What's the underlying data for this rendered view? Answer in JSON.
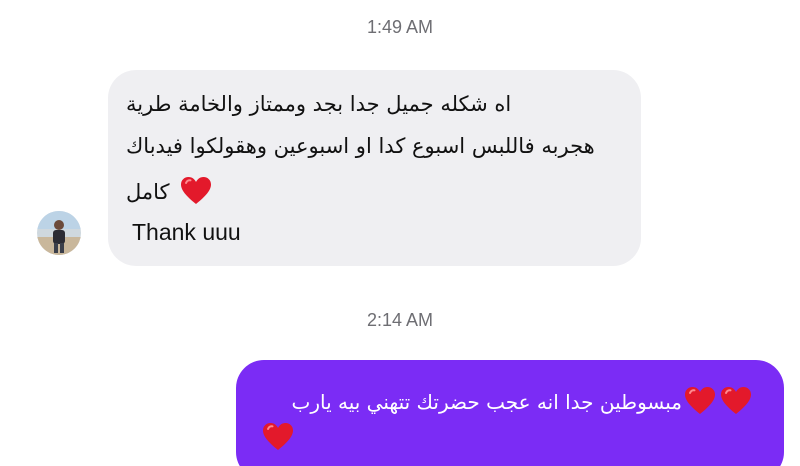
{
  "timestamps": {
    "first": "1:49 AM",
    "second": "2:14 AM"
  },
  "incoming": {
    "line1": "اه شكله جميل جدا بجد وممتاز والخامة طرية",
    "line2": "هجربه فاللبس اسبوع كدا او اسبوعين وهقولكوا فيدباك",
    "line3": "كامل",
    "line4": "Thank uuu",
    "heart_icon": "red-heart-icon"
  },
  "outgoing": {
    "line1": "مبسوطين جدا انه عجب حضرتك تتهني بيه يارب",
    "heart_icon": "red-heart-icon"
  },
  "colors": {
    "incoming_bubble": "#efeff2",
    "outgoing_bubble": "#7b2cf5",
    "heart": "#e3192b",
    "timestamp": "#6e6e73"
  }
}
